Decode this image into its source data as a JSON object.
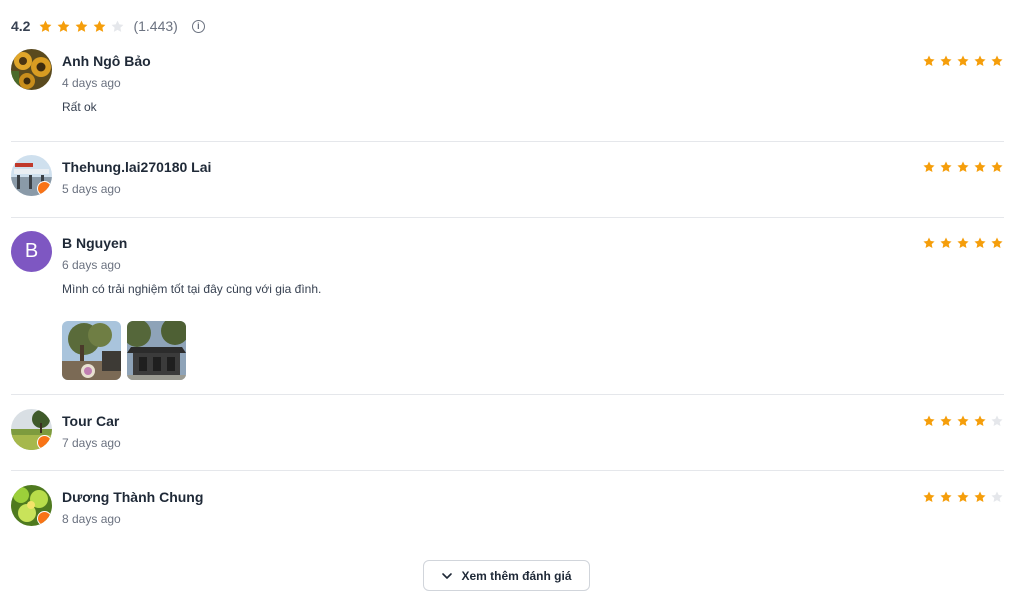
{
  "summary": {
    "score": "4.2",
    "stars": 4,
    "count": "(1.443)",
    "info_symbol": "i"
  },
  "colors": {
    "star_filled": "#f59e0b",
    "star_empty": "#e5e7eb",
    "avatar_b": "#7e57c2",
    "badge": "#f97316"
  },
  "reviews": [
    {
      "name": "Anh Ngô Bảo",
      "date": "4 days ago",
      "text": "Rất ok",
      "rating": 5,
      "avatar": "sunflower-photo"
    },
    {
      "name": "Thehung.lai270180 Lai",
      "date": "5 days ago",
      "text": "",
      "rating": 5,
      "avatar": "building-photo"
    },
    {
      "name": "B Nguyen",
      "date": "6 days ago",
      "text": "Mình có trải nghiệm tốt tại đây cùng với gia đình.",
      "rating": 5,
      "avatar_letter": "B",
      "photos": [
        "tree-photo",
        "gate-photo"
      ]
    },
    {
      "name": "Tour Car",
      "date": "7 days ago",
      "text": "",
      "rating": 4,
      "avatar": "field-photo"
    },
    {
      "name": "Dương Thành Chung",
      "date": "8 days ago",
      "text": "",
      "rating": 4,
      "avatar": "flower-photo"
    }
  ],
  "more_button": {
    "label": "Xem thêm đánh giá",
    "icon": "chevron-down-icon"
  }
}
